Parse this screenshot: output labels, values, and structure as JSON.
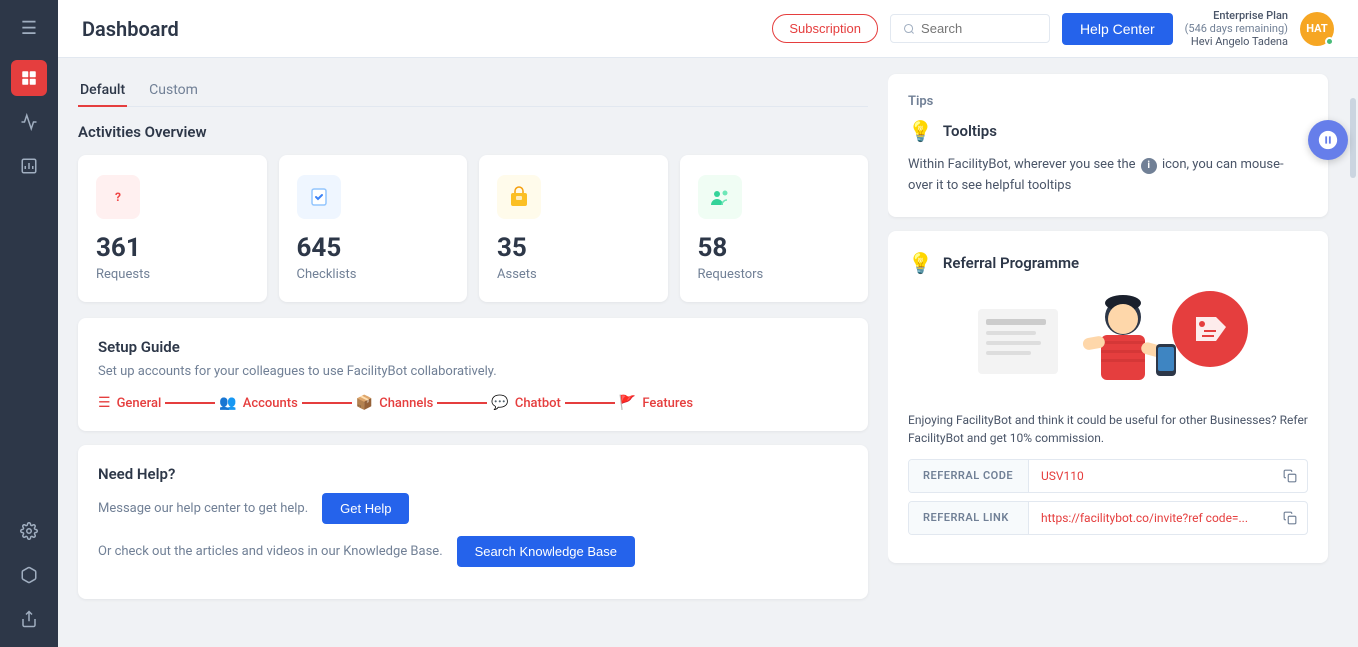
{
  "sidebar": {
    "menu_icon": "☰",
    "items": [
      {
        "id": "home",
        "icon": "⊞",
        "active": true
      },
      {
        "id": "chart-line",
        "icon": "📈",
        "active": false
      },
      {
        "id": "bar-chart",
        "icon": "📊",
        "active": false
      },
      {
        "id": "settings",
        "icon": "⚙",
        "active": false
      },
      {
        "id": "cube",
        "icon": "◈",
        "active": false
      },
      {
        "id": "flag",
        "icon": "⚑",
        "active": false
      }
    ]
  },
  "header": {
    "title": "Dashboard",
    "subscription_label": "Subscription",
    "search_placeholder": "Search",
    "help_center_label": "Help Center",
    "user": {
      "plan": "Enterprise Plan",
      "days_remaining": "(546 days remaining)",
      "name": "Hevi Angelo Tadena",
      "initials": "HAT"
    }
  },
  "tabs": [
    {
      "id": "default",
      "label": "Default",
      "active": true
    },
    {
      "id": "custom",
      "label": "Custom",
      "active": false
    }
  ],
  "activities": {
    "section_title": "Activities Overview",
    "cards": [
      {
        "id": "requests",
        "number": "361",
        "label": "Requests",
        "icon_char": "?",
        "icon_color": "#ef4444",
        "icon_bg": "#fff0f0"
      },
      {
        "id": "checklists",
        "number": "645",
        "label": "Checklists",
        "icon_char": "✓",
        "icon_color": "#3b82f6",
        "icon_bg": "#eff6ff"
      },
      {
        "id": "assets",
        "number": "35",
        "label": "Assets",
        "icon_char": "📦",
        "icon_color": "#f59e0b",
        "icon_bg": "#fffbeb"
      },
      {
        "id": "requestors",
        "number": "58",
        "label": "Requestors",
        "icon_char": "👤",
        "icon_color": "#10b981",
        "icon_bg": "#f0fdf4"
      }
    ]
  },
  "setup_guide": {
    "title": "Setup Guide",
    "description": "Set up accounts for your colleagues to use FacilityBot collaboratively.",
    "steps": [
      {
        "id": "general",
        "label": "General",
        "icon": "☰"
      },
      {
        "id": "accounts",
        "label": "Accounts",
        "icon": "👥"
      },
      {
        "id": "channels",
        "label": "Channels",
        "icon": "📦"
      },
      {
        "id": "chatbot",
        "label": "Chatbot",
        "icon": "💬"
      },
      {
        "id": "features",
        "label": "Features",
        "icon": "🚩"
      }
    ]
  },
  "need_help": {
    "title": "Need Help?",
    "message_text": "Message our help center to get help.",
    "get_help_label": "Get Help",
    "kb_text": "Or check out the articles and videos in our Knowledge Base.",
    "kb_button_label": "Search Knowledge Base"
  },
  "tips": {
    "section_title": "Tips",
    "tooltips_title": "Tooltips",
    "tooltips_text_before": "Within FacilityBot, wherever you see the",
    "tooltips_text_after": "icon, you can mouse-over it to see helpful tooltips"
  },
  "referral": {
    "title": "Referral Programme",
    "description": "Enjoying FacilityBot and think it could be useful for other Businesses? Refer FacilityBot and get 10% commission.",
    "referral_code_label": "REFERRAL CODE",
    "referral_code_value": "USV110",
    "referral_link_label": "REFERRAL LINK",
    "referral_link_value": "https://facilitybot.co/invite?ref code=..."
  }
}
